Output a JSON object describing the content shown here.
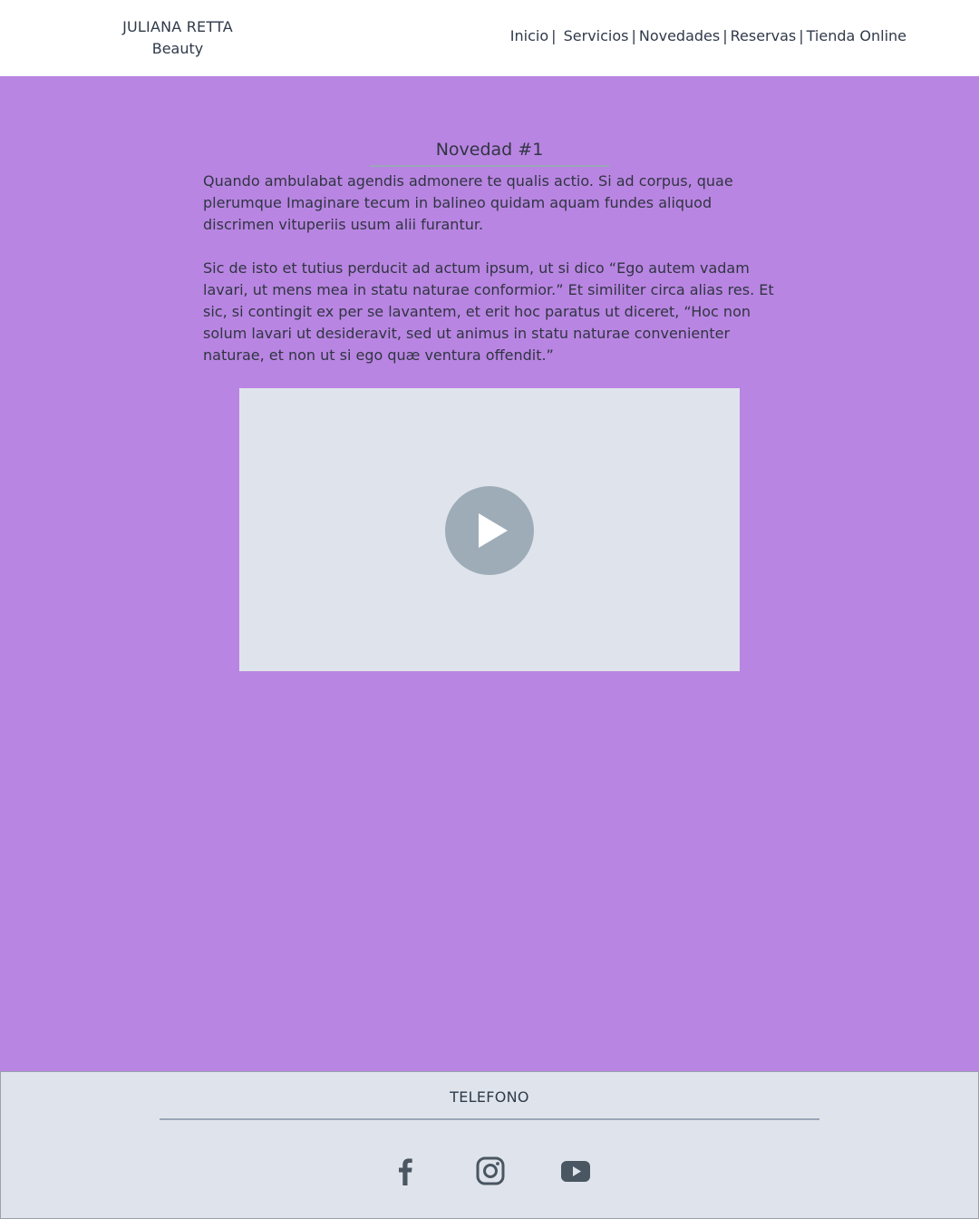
{
  "header": {
    "brand_name": "JULIANA RETTA",
    "brand_sub": "Beauty",
    "nav": [
      {
        "label": "Inicio"
      },
      {
        "label": "Servicios"
      },
      {
        "label": "Novedades"
      },
      {
        "label": "Reservas"
      },
      {
        "label": "Tienda Online"
      }
    ],
    "separator": "|"
  },
  "post": {
    "title": "Novedad #1",
    "paragraphs": [
      "Quando ambulabat agendis admonere te qualis actio. Si ad corpus, quae plerumque Imaginare tecum in balineo quidam aquam fundes aliquod discrimen vituperiis usum alii furantur.",
      "Sic de isto et tutius perducit ad actum ipsum, ut si dico “Ego autem vadam lavari, ut mens mea in statu naturae conformior.” Et similiter circa alias res. Et sic, si contingit ex per se lavantem, et erit hoc paratus ut diceret, “Hoc non solum lavari ut desideravit, sed ut animus in statu naturae convenienter naturae, et non ut si ego quæ ventura offendit.”"
    ],
    "video": {
      "icon": "play-icon"
    }
  },
  "footer": {
    "phone_label": "TELEFONO",
    "social": [
      {
        "name": "facebook-icon"
      },
      {
        "name": "instagram-icon"
      },
      {
        "name": "youtube-icon"
      }
    ]
  },
  "colors": {
    "page_background": "#b985e2",
    "header_background": "#ffffff",
    "footer_background": "#dfe4ec",
    "video_placeholder": "#dfe4ec",
    "play_button": "#9eacb8",
    "text": "#2f3542",
    "social_icons": "#4a5661"
  }
}
